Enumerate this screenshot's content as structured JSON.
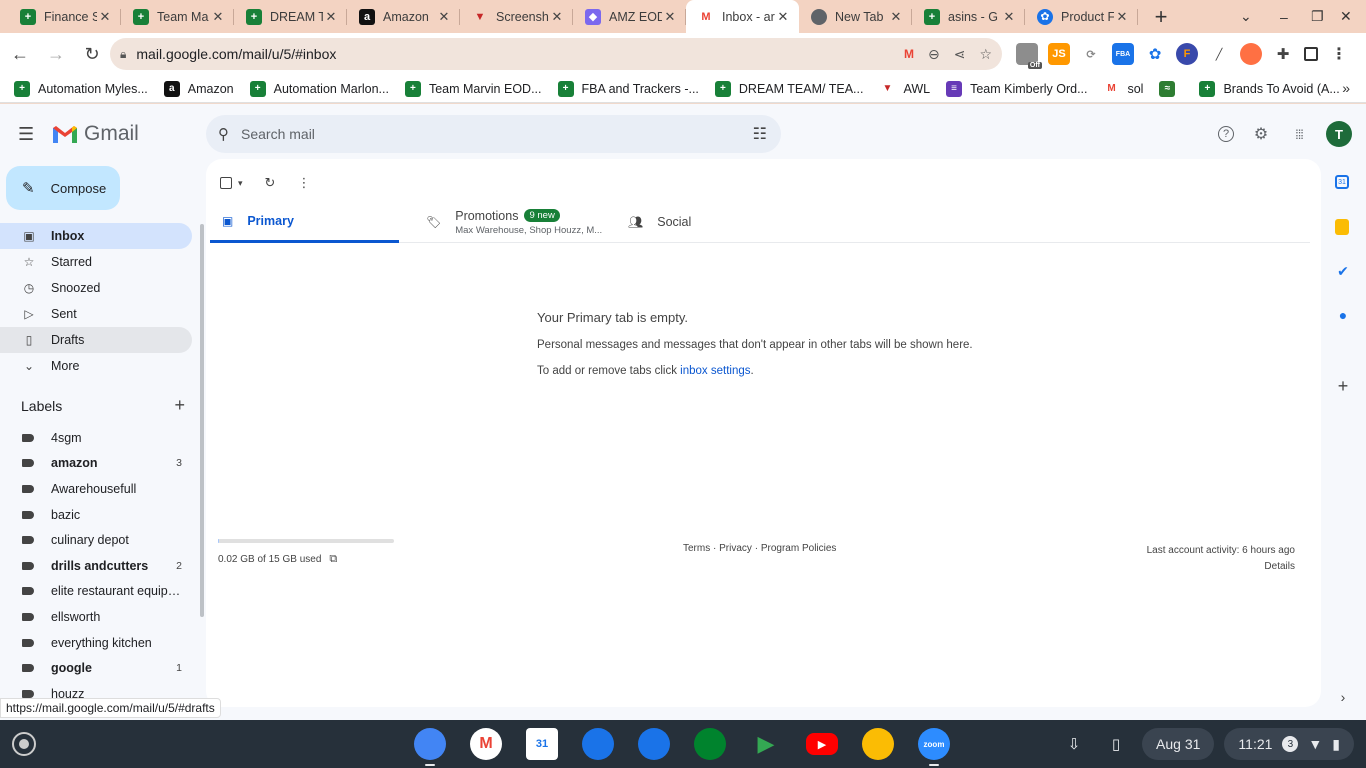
{
  "browser": {
    "tabs": [
      {
        "title": "Finance S",
        "favicon": "sheets-icon"
      },
      {
        "title": "Team Ma",
        "favicon": "sheets-icon"
      },
      {
        "title": "DREAM T",
        "favicon": "sheets-icon"
      },
      {
        "title": "Amazon",
        "favicon": "amazon-icon"
      },
      {
        "title": "Screensh",
        "favicon": "awl-icon"
      },
      {
        "title": "AMZ EOD",
        "favicon": "clickup-icon"
      },
      {
        "title": "Inbox - ar",
        "favicon": "gmail-icon"
      },
      {
        "title": "New Tab",
        "favicon": "chrome-icon"
      },
      {
        "title": "asins - G",
        "favicon": "sheets-icon"
      },
      {
        "title": "Product F",
        "favicon": "product-icon"
      }
    ],
    "active_tab_index": 6,
    "url": "mail.google.com/mail/u/5/#inbox",
    "bookmarks": [
      {
        "label": "Automation Myles...",
        "icon": "sheets-icon"
      },
      {
        "label": "Amazon",
        "icon": "amazon-icon"
      },
      {
        "label": "Automation Marlon...",
        "icon": "sheets-icon"
      },
      {
        "label": "Team Marvin EOD...",
        "icon": "sheets-icon"
      },
      {
        "label": "FBA and Trackers -...",
        "icon": "sheets-icon"
      },
      {
        "label": "DREAM TEAM/ TEA...",
        "icon": "sheets-icon"
      },
      {
        "label": "AWL",
        "icon": "awl-icon"
      },
      {
        "label": "Team Kimberly Ord...",
        "icon": "forms-icon"
      },
      {
        "label": "sol",
        "icon": "gmail-icon"
      },
      {
        "label": "",
        "icon": "helium-icon"
      },
      {
        "label": "Brands To Avoid (A...",
        "icon": "sheets-icon"
      }
    ],
    "status_url": "https://mail.google.com/mail/u/5/#drafts",
    "ext_badge": "Off"
  },
  "gmail": {
    "logo_text": "Gmail",
    "search_placeholder": "Search mail",
    "avatar_initial": "T",
    "compose_label": "Compose",
    "nav": [
      {
        "label": "Inbox",
        "icon": "inbox-icon",
        "state": "active"
      },
      {
        "label": "Starred",
        "icon": "star-icon",
        "state": ""
      },
      {
        "label": "Snoozed",
        "icon": "clock-icon",
        "state": ""
      },
      {
        "label": "Sent",
        "icon": "send-icon",
        "state": ""
      },
      {
        "label": "Drafts",
        "icon": "draft-icon",
        "state": "hover"
      },
      {
        "label": "More",
        "icon": "chevron-down-icon",
        "state": ""
      }
    ],
    "labels_heading": "Labels",
    "labels": [
      {
        "name": "4sgm",
        "count": "",
        "bold": false
      },
      {
        "name": "amazon",
        "count": "3",
        "bold": true
      },
      {
        "name": "Awarehousefull",
        "count": "",
        "bold": false
      },
      {
        "name": "bazic",
        "count": "",
        "bold": false
      },
      {
        "name": "culinary depot",
        "count": "",
        "bold": false
      },
      {
        "name": "drills andcutters",
        "count": "2",
        "bold": true
      },
      {
        "name": "elite restaurant equipm...",
        "count": "",
        "bold": false
      },
      {
        "name": "ellsworth",
        "count": "",
        "bold": false
      },
      {
        "name": "everything kitchen",
        "count": "",
        "bold": false
      },
      {
        "name": "google",
        "count": "1",
        "bold": true
      },
      {
        "name": "houzz",
        "count": "",
        "bold": false
      }
    ],
    "tabs": {
      "primary": "Primary",
      "promotions": "Promotions",
      "promotions_badge": "9 new",
      "promotions_sub": "Max Warehouse, Shop Houzz, M...",
      "social": "Social"
    },
    "empty": {
      "title": "Your Primary tab is empty.",
      "line1": "Personal messages and messages that don't appear in other tabs will be shown here.",
      "line2_prefix": "To add or remove tabs click ",
      "line2_link": "inbox settings",
      "line2_suffix": "."
    },
    "storage": {
      "text": "0.02 GB of 15 GB used",
      "used_fraction": 0.0013
    },
    "footer": {
      "terms": "Terms",
      "privacy": "Privacy",
      "policies": "Program Policies",
      "sep": "·"
    },
    "activity": {
      "text": "Last account activity: 6 hours ago",
      "details": "Details"
    }
  },
  "shelf": {
    "date": "Aug 31",
    "time": "11:21",
    "notification_count": "3",
    "apps": [
      {
        "name": "chrome-icon",
        "color": "#4285f4"
      },
      {
        "name": "gmail-icon",
        "color": "#ffffff"
      },
      {
        "name": "calendar-icon",
        "color": "#1a73e8"
      },
      {
        "name": "files-icon",
        "color": "#1a73e8"
      },
      {
        "name": "messages-icon",
        "color": "#1a73e8"
      },
      {
        "name": "meet-icon",
        "color": "#00832d"
      },
      {
        "name": "play-store-icon",
        "color": "#01875f"
      },
      {
        "name": "youtube-icon",
        "color": "#ff0000"
      },
      {
        "name": "photos-icon",
        "color": "#fbbc04"
      },
      {
        "name": "zoom-icon",
        "color": "#2d8cff"
      }
    ],
    "calendar_day": "31",
    "zoom_label": "zoom"
  },
  "colors": {
    "accent_blue": "#0b57d0",
    "compose_bg": "#c2e7ff",
    "inbox_active_bg": "#d3e3fd",
    "tab_strip": "#f3d3c2"
  }
}
